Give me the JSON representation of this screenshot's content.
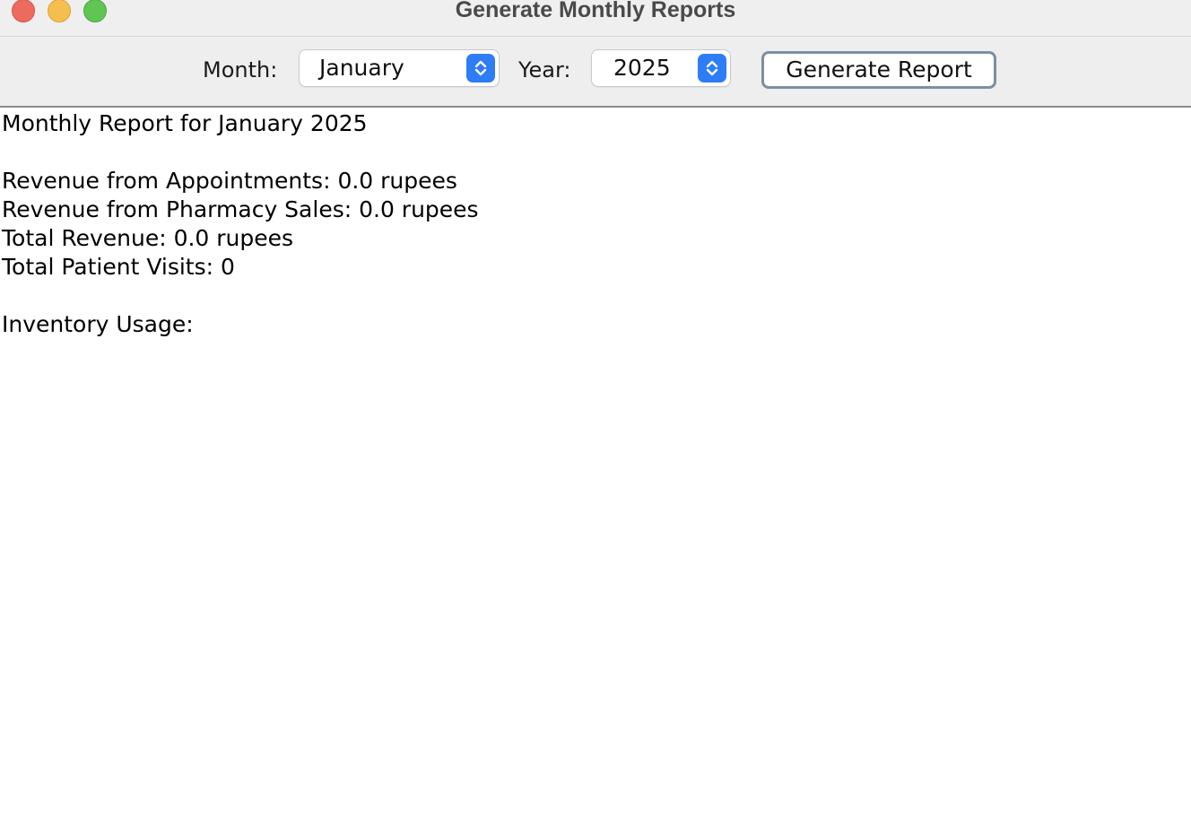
{
  "window": {
    "title": "Generate Monthly Reports"
  },
  "toolbar": {
    "month_label": "Month:",
    "month_value": "January",
    "year_label": "Year:",
    "year_value": "2025",
    "generate_label": "Generate Report"
  },
  "report": {
    "lines": [
      "Monthly Report for January 2025",
      "",
      "Revenue from Appointments: 0.0 rupees",
      "Revenue from Pharmacy Sales: 0.0 rupees",
      "Total Revenue: 0.0 rupees",
      "Total Patient Visits: 0",
      "",
      "Inventory Usage:"
    ]
  },
  "colors": {
    "accent": "#2e7cf6",
    "close": "#ed6a5e",
    "minimize": "#f5bf4f",
    "zoom": "#61c554"
  },
  "icons": {
    "stepper": "up-down-chevron-icon"
  }
}
